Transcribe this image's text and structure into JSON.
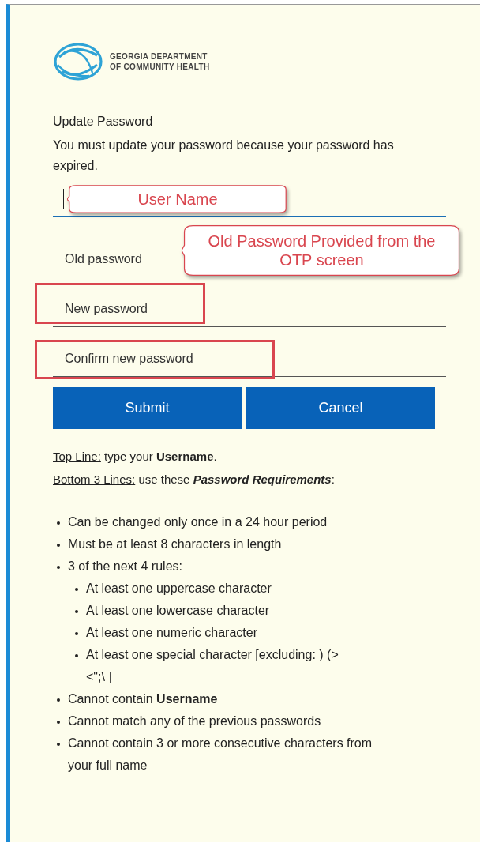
{
  "logo": {
    "lines": [
      "GEORGIA DEPARTMENT",
      "OF COMMUNITY HEALTH"
    ]
  },
  "heading": "Update Password",
  "message": "You must update your password because your password has expired.",
  "fields": [
    {
      "focused": true,
      "annotation": {
        "kind": "callout",
        "text": "User Name"
      }
    },
    {
      "placeholder": "Old password",
      "focused": false,
      "annotation": {
        "kind": "callout",
        "text": "Old Password Provided from the OTP screen"
      }
    },
    {
      "placeholder": "New password",
      "focused": false,
      "annotation": {
        "kind": "box"
      }
    },
    {
      "placeholder": "Confirm new password",
      "focused": false,
      "annotation": {
        "kind": "box"
      }
    }
  ],
  "buttons": [
    "Submit",
    "Cancel"
  ],
  "instructions": [
    {
      "label": "Top Line:",
      "text": "type your **Username**."
    },
    {
      "label": "Bottom 3 Lines:",
      "text": "use these **Password Requirements**:"
    }
  ],
  "requirements": [
    {
      "text": "Can be changed only once in a 24 hour period"
    },
    {
      "text": "Must be at least 8 characters in length"
    },
    {
      "text": "3 of the next 4 rules:",
      "children": [
        {
          "text": "At least one uppercase character"
        },
        {
          "text": "At least one lowercase character"
        },
        {
          "text": "At least one numeric character"
        },
        {
          "text": "At least one special character [excluding: ) (> <\";\\ ]"
        }
      ]
    },
    {
      "text": "Cannot contain **Username**"
    },
    {
      "text": "Cannot match any of the previous passwords"
    },
    {
      "text": "Cannot contain 3 or more consecutive characters from your full name"
    }
  ]
}
